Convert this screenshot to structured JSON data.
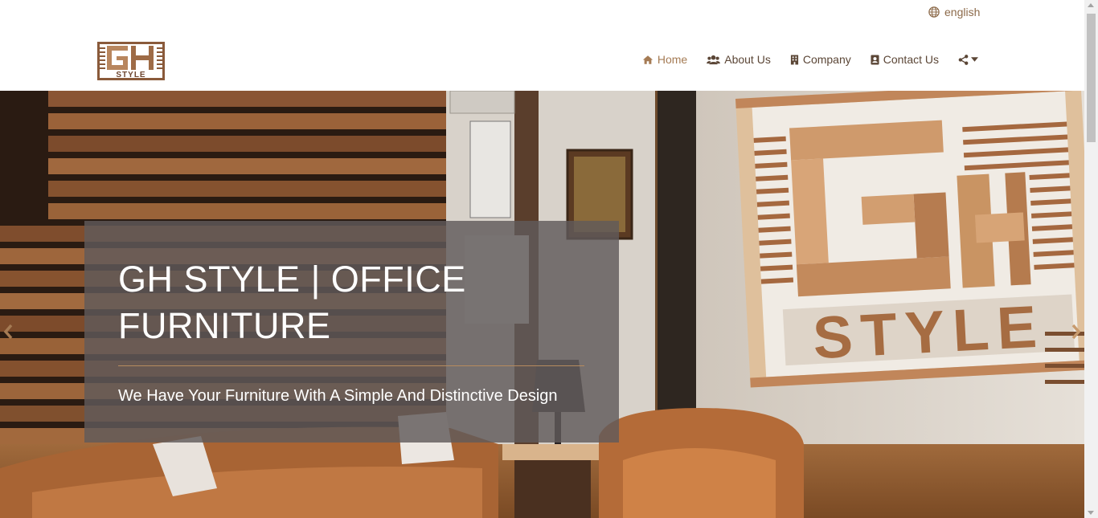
{
  "topbar": {
    "language_label": "english"
  },
  "brand": {
    "logo_alt": "GH STYLE"
  },
  "nav": {
    "items": [
      {
        "label": "Home",
        "icon": "home-icon",
        "active": true
      },
      {
        "label": "About Us",
        "icon": "users-icon",
        "active": false
      },
      {
        "label": "Company",
        "icon": "building-icon",
        "active": false
      },
      {
        "label": "Contact Us",
        "icon": "contact-card-icon",
        "active": false
      }
    ],
    "share_icon": "share-icon"
  },
  "hero": {
    "title": "GH STYLE | OFFICE FURNITURE",
    "subtitle": "We Have Your Furniture With A Simple And Distinctive Design",
    "accent_color": "#a57b54"
  }
}
